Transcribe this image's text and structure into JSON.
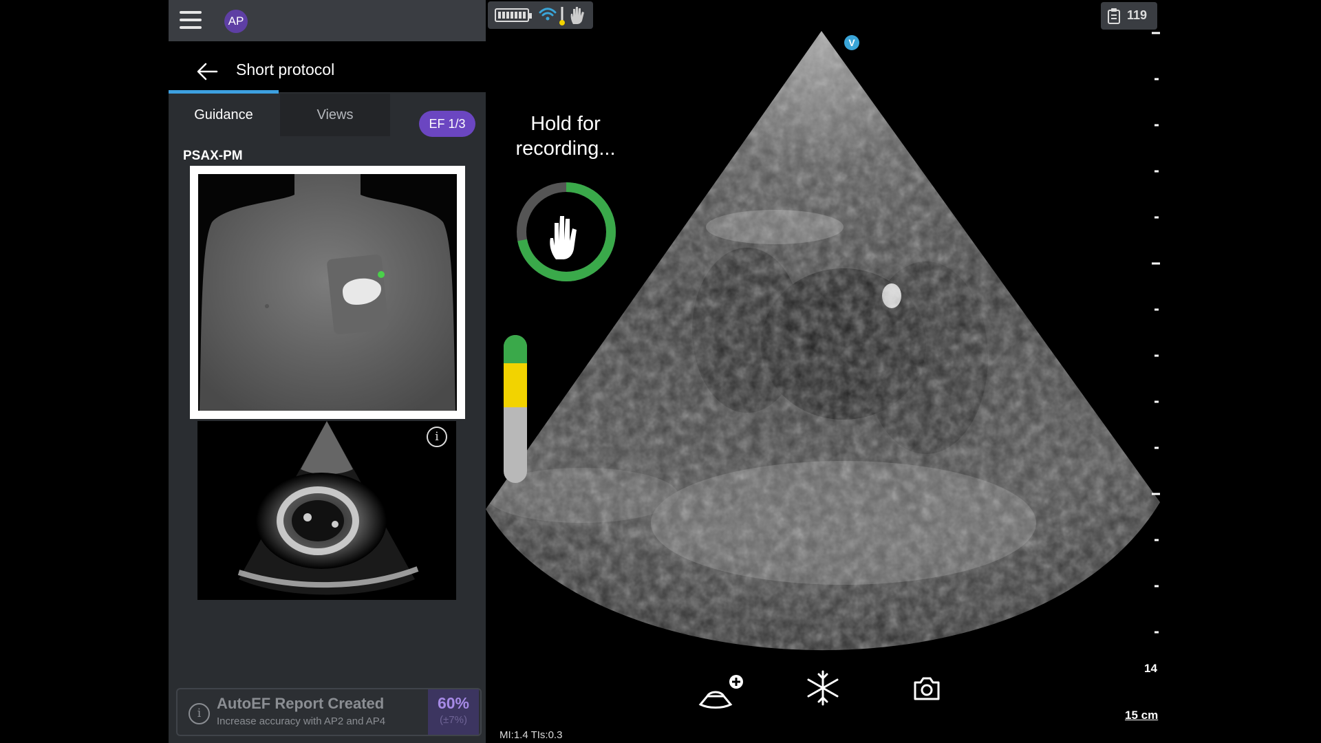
{
  "header": {
    "avatar_initials": "AP",
    "back_label": "Short protocol"
  },
  "tabs": [
    {
      "label": "Guidance",
      "active": true
    },
    {
      "label": "Views",
      "active": false
    }
  ],
  "ef_badge": "EF 1/3",
  "view": {
    "label": "PSAX-PM"
  },
  "report": {
    "title": "AutoEF Report Created",
    "subtitle": "Increase accuracy with AP2 and AP4",
    "ef_value": "60%",
    "ef_range": "(±7%)"
  },
  "status": {
    "count": "119",
    "icons": [
      "battery-icon",
      "wifi-icon",
      "thermometer-icon",
      "hand-icon",
      "clipboard-icon"
    ]
  },
  "recording": {
    "hold_text_line1": "Hold for",
    "hold_text_line2": "recording...",
    "progress": 0.72
  },
  "quality_meter": {
    "green_fraction": 0.19,
    "yellow_fraction": 0.3
  },
  "ultrasound": {
    "orientation_marker": "V",
    "depth_marker": "14",
    "depth_label": "15 cm",
    "mi_readout": "MI:1.4  TIs:0.3"
  },
  "colors": {
    "accent_purple": "#6b46c1",
    "tab_indicator": "#3da0e0",
    "ring_green": "#3aa94a",
    "meter_yellow": "#f2d300"
  }
}
